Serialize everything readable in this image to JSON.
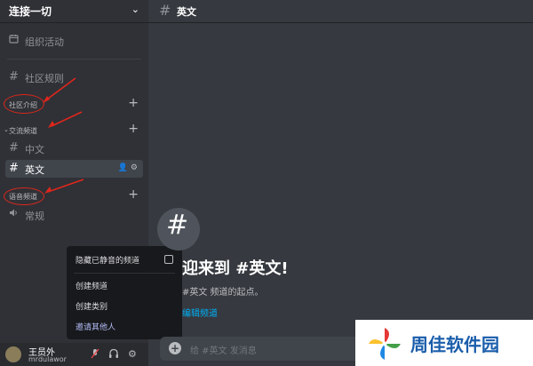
{
  "server": {
    "name": "连接一切"
  },
  "sidebar": {
    "events_label": "组织活动",
    "rules_label": "社区规则",
    "categories": [
      {
        "label": "社区介绍"
      },
      {
        "label": "交流频道"
      },
      {
        "label": "语音频道"
      }
    ],
    "channels": {
      "chinese": "中文",
      "english": "英文",
      "voice_general": "常规"
    }
  },
  "context_menu": {
    "hide_muted": "隐藏已静音的频道",
    "create_channel": "创建频道",
    "create_category": "创建类别",
    "invite_people": "邀请其他人"
  },
  "user_panel": {
    "username": "王员外",
    "tag": "mrdulawor"
  },
  "main": {
    "header_title": "英文",
    "welcome_title": "迎来到 #英文!",
    "welcome_subtitle": "#英文 频道的起点。",
    "welcome_link": "编辑频道",
    "message_placeholder": "给 #英文 发消息"
  },
  "watermark": {
    "text": "周佳软件园"
  },
  "colors": {
    "sidebar_bg": "#2f3136",
    "main_bg": "#36393f",
    "annotation_red": "#e0261c",
    "link_blue": "#00aff4"
  }
}
